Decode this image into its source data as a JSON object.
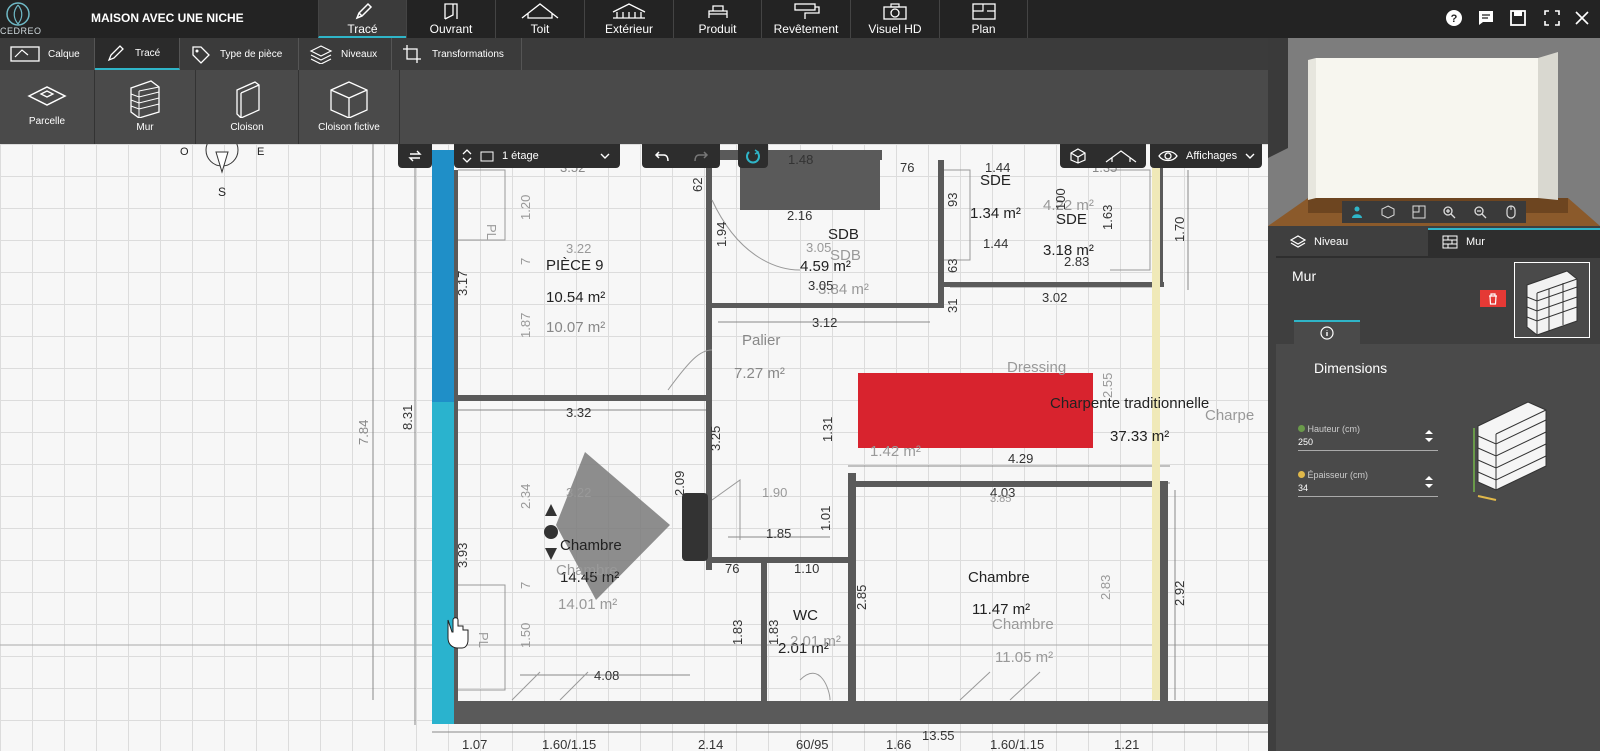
{
  "app": {
    "logo_text": "CEDREO",
    "doc_title": "MAISON AVEC UNE NICHE"
  },
  "main_tabs": [
    {
      "label": "Tracé",
      "icon": "pencil-icon"
    },
    {
      "label": "Ouvrant",
      "icon": "door-icon"
    },
    {
      "label": "Toit",
      "icon": "roof-icon"
    },
    {
      "label": "Extérieur",
      "icon": "exterior-icon"
    },
    {
      "label": "Produit",
      "icon": "product-icon"
    },
    {
      "label": "Revêtement",
      "icon": "paint-roller-icon"
    },
    {
      "label": "Visuel HD",
      "icon": "camera-icon"
    },
    {
      "label": "Plan",
      "icon": "plan-icon"
    }
  ],
  "sub_tabs": [
    {
      "label": "Calque",
      "icon": "layer-icon"
    },
    {
      "label": "Tracé",
      "icon": "pencil-icon"
    },
    {
      "label": "Type de pièce",
      "icon": "tag-icon"
    },
    {
      "label": "Niveaux",
      "icon": "levels-icon"
    },
    {
      "label": "Transformations",
      "icon": "transform-icon"
    }
  ],
  "tools": [
    {
      "label": "Parcelle",
      "icon": "parcel-icon"
    },
    {
      "label": "Mur",
      "icon": "brick-wall-icon"
    },
    {
      "label": "Cloison",
      "icon": "partition-icon"
    },
    {
      "label": "Cloison fictive",
      "icon": "fictive-partition-icon"
    }
  ],
  "floating_bar": {
    "level_select": "1 étage",
    "display_label": "Affichages"
  },
  "compass": {
    "west": "O",
    "east": "E",
    "south": "S"
  },
  "rooms": [
    {
      "name": "PIÈCE 9",
      "area": "10.54 m²",
      "area2": "10.07 m²"
    },
    {
      "name": "SDB",
      "area": "4.59 m²",
      "ghost_name": "SDB",
      "ghost_area": "3.84 m²"
    },
    {
      "name": "SDE",
      "area": "1.34 m²"
    },
    {
      "name": "SDE",
      "area": "3.18 m²",
      "ghost_area": "4.22 m²"
    },
    {
      "name": "Palier",
      "area": "7.27 m²"
    },
    {
      "name": "Dressing"
    },
    {
      "name": "Charpente traditionnelle",
      "area": "37.33 m²",
      "ghost_name": "Charpe",
      "ghost_area": "1.42 m²"
    },
    {
      "name": "Chambre",
      "area": "14.45 m²",
      "ghost_name": "Chambre",
      "ghost_area": "14.01 m²"
    },
    {
      "name": "WC",
      "area": "2.01 m²",
      "ghost_area": "2.01 m²"
    },
    {
      "name": "Chambre",
      "area": "11.47 m²",
      "ghost_name": "Chambre",
      "ghost_area": "11.05 m²"
    }
  ],
  "dimensions": {
    "top": [
      "3.52",
      "1.48",
      "76",
      "1.44",
      "1.35"
    ],
    "d_8_31": "8.31",
    "d_7_84": "7.84",
    "d_3_17": "3.17",
    "d_1_20": "1.20",
    "d_1_87": "1.87",
    "d_3_22a": "3.22",
    "d_3_22b": "3.22",
    "d_3_32": "3.32",
    "d_3_25": "3.25",
    "d_3_93": "3.93",
    "d_2_34": "2.34",
    "d_2_09": "2.09",
    "d_1_90": "1.90",
    "d_1_85": "1.85",
    "d_1_50": "1.50",
    "d_4_08": "4.08",
    "d_76b": "76",
    "d_1_10": "1.10",
    "d_1_83a": "1.83",
    "d_1_83b": "1.83",
    "d_2_85": "2.85",
    "d_1_01": "1.01",
    "d_1_31": "1.31",
    "d_4_29": "4.29",
    "d_4_03": "4.03",
    "d_3_85": "3.85",
    "d_2_83": "2.83",
    "d_2_92": "2.92",
    "d_2_55": "2.55",
    "d_3_12": "3.12",
    "d_3_02": "3.02",
    "d_2_16": "2.16",
    "d_1_94": "1.94",
    "d_3_05a": "3.05",
    "d_3_05b": "3.05",
    "d_1_44": "1.44",
    "d_2_83b": "2.83",
    "d_1_70": "1.70",
    "d_1_63": "1.63",
    "d_93": "93",
    "d_100": "100",
    "d_63": "63",
    "d_31": "31",
    "d_62": "62",
    "d_7a": "7",
    "d_7b": "7",
    "d_13_55": "13.55",
    "bottom": [
      "1.07",
      "1.60/1.15",
      "2.14",
      "60/95",
      "1.66",
      "1.60/1.15",
      "1.21"
    ],
    "pl_a": "PL",
    "pl_b": "PL"
  },
  "preview_controls": [
    "person-icon",
    "cube-icon",
    "plan-view-icon",
    "zoom-in-icon",
    "zoom-out-icon",
    "mouse-icon"
  ],
  "panel": {
    "tab_level": "Niveau",
    "tab_wall": "Mur",
    "selection_title": "Mur",
    "section_title": "Dimensions",
    "height_label": "Hauteur (cm)",
    "height_value": "250",
    "thickness_label": "Épaisseur (cm)",
    "thickness_value": "34"
  },
  "colors": {
    "accent": "#2fb5c8",
    "wall_selected": "#1f8fc8",
    "highlight": "#d8232e",
    "delete": "#e53935"
  }
}
